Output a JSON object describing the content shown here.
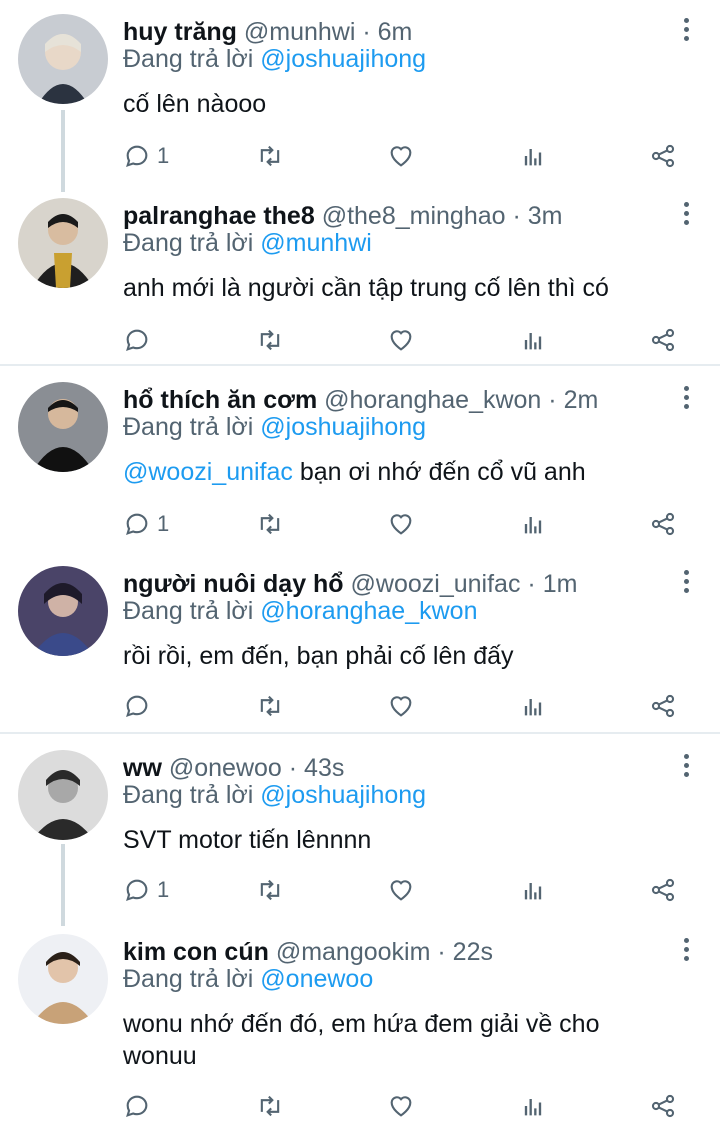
{
  "tweets": [
    {
      "name": "huy trăng",
      "handle": "@munhwi",
      "time": "· 6m",
      "reply_prefix": "Đang trả lời ",
      "reply_to": "@joshuajihong",
      "mention": "",
      "text": "cố lên nàooo",
      "reply_count": "1",
      "avatar_color": "#2b3340"
    },
    {
      "name": "palranghae the8",
      "handle": "@the8_minghao",
      "time": "· 3m",
      "reply_prefix": "Đang trả lời ",
      "reply_to": "@munhwi",
      "mention": "",
      "text": "anh mới là người cần tập trung cố lên thì có",
      "reply_count": "",
      "avatar_color": "#5a4a3a"
    },
    {
      "name": "hổ thích ăn cơm",
      "handle": "@horanghae_kwon",
      "time": "· 2m",
      "reply_prefix": "Đang trả lời ",
      "reply_to": "@joshuajihong",
      "mention": "@woozi_unifac",
      "text": " bạn ơi nhớ đến cổ vũ anh",
      "reply_count": "1",
      "avatar_color": "#3a3c40"
    },
    {
      "name": "người nuôi dạy hổ",
      "handle": "@woozi_unifac",
      "time": "· 1m",
      "reply_prefix": "Đang trả lời ",
      "reply_to": "@horanghae_kwon",
      "mention": "",
      "text": "rồi rồi, em đến, bạn phải cố lên đấy",
      "reply_count": "",
      "avatar_color": "#6b5a8a"
    },
    {
      "name": "ww",
      "handle": "@onewoo",
      "time": "· 43s",
      "reply_prefix": "Đang trả lời ",
      "reply_to": "@joshuajihong",
      "mention": "",
      "text": "SVT motor tiến lênnnn",
      "reply_count": "1",
      "avatar_color": "#8a8a8a"
    },
    {
      "name": "kim con cún",
      "handle": "@mangookim",
      "time": "· 22s",
      "reply_prefix": "Đang trả lời ",
      "reply_to": "@onewoo",
      "mention": "",
      "text": "wonu nhớ đến đó, em hứa đem giải về cho wonuu",
      "reply_count": "",
      "avatar_color": "#c9a98a"
    }
  ]
}
